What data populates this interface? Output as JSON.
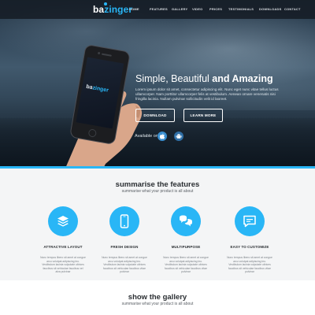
{
  "brand": {
    "name_part1": "ba",
    "name_part2": "zinger",
    "accent": "#29b6f6"
  },
  "nav": {
    "items": [
      "HOME",
      "FEATURES",
      "GALLERY",
      "VIDEO",
      "PRICES",
      "TESTIMONIALS",
      "DOWNLOADS",
      "CONTACT"
    ]
  },
  "hero": {
    "headline_plain": "Simple, Beautiful",
    "headline_bold": "and Amazing",
    "body": "Lorem ipsum dolor sit amet, consectetur adipiscing elit. Nunc eget nunc vitae tellus luctus ullamcorper. Nam porttitor ullamcorper felis at vestibulum. Aenean ornare venenatis nisi fringilla lacinia. Nullam pulvinar sollicitudin velit id laoreet.",
    "download_label": "DOWNLOAD",
    "learn_label": "LEARN MORE",
    "available_on": "Available on:",
    "phone_brand_part1": "ba",
    "phone_brand_part2": "zinger"
  },
  "features": {
    "title": "summarise the features",
    "subtitle": "summarise what your product is all about",
    "items": [
      {
        "icon": "layers-icon",
        "title": "ATTRACTIVE LAYOUT",
        "desc": "Nunc tempus libero sit amet at congue arcu volutpat adipiscing leo. Vestibulum lacinia vulputate ultrices faucibus sit vehiculae faucibus vel alva pulvinar"
      },
      {
        "icon": "mobile-icon",
        "title": "FRESH DESIGN",
        "desc": "Nunc tempus libero sit amet at congue arcu volutpat adipiscing leo. Vestibulum lacinia vulputate ultrices faucibus sit vehiculae faucibus vitae pulvinar"
      },
      {
        "icon": "chat-icon",
        "title": "MULTIPURPOSE",
        "desc": "Nunc tempus libero sit amet at congue arcu volutpat adipiscing leo. Vestibulum lacinia vulputate ultrices faucibus sit vehiculae faucibus vitae pulvinar"
      },
      {
        "icon": "speech-bubble-icon",
        "title": "EASY TO CUSTOMIZE",
        "desc": "Nunc tempus libero sit amet at congue arcu volutpat adipiscing leo. Vestibulum lacinia vulputate ultrices faucibus sit vehiculae faucibus vitae pulvinar"
      }
    ]
  },
  "gallery": {
    "title": "show the gallery",
    "subtitle": "summarise what your product is all about"
  }
}
